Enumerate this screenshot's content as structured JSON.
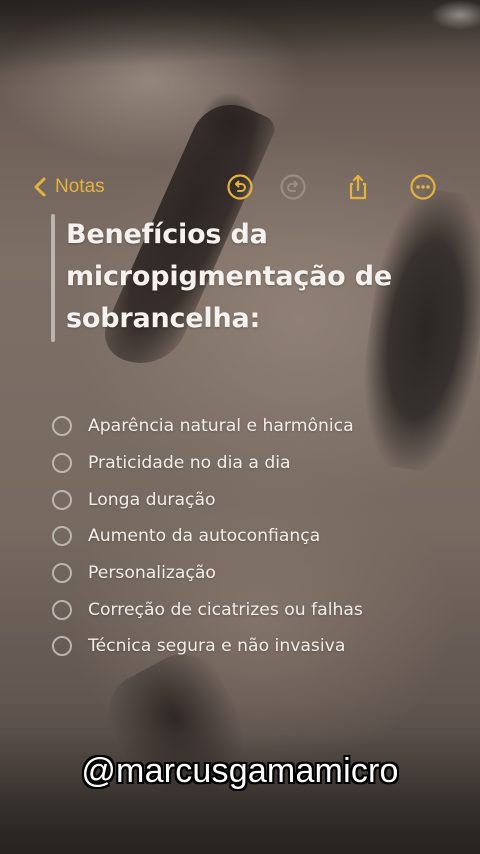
{
  "notes_toolbar": {
    "back_label": "Notas",
    "accent_color": "#e4b33b",
    "icons": [
      "chevron-left-icon",
      "undo-icon",
      "redo-icon",
      "share-icon",
      "more-icon"
    ]
  },
  "note": {
    "title": "Benefícios da micropigmentação de sobrancelha:",
    "checklist": [
      {
        "label": "Aparência natural e harmônica",
        "checked": false
      },
      {
        "label": "Praticidade no dia a dia",
        "checked": false
      },
      {
        "label": "Longa duração",
        "checked": false
      },
      {
        "label": "Aumento da autoconfiança",
        "checked": false
      },
      {
        "label": "Personalização",
        "checked": false
      },
      {
        "label": "Correção de cicatrizes ou falhas",
        "checked": false
      },
      {
        "label": "Técnica segura e não invasiva",
        "checked": false
      }
    ]
  },
  "overlay": {
    "handle": "@marcusgamamicro"
  }
}
